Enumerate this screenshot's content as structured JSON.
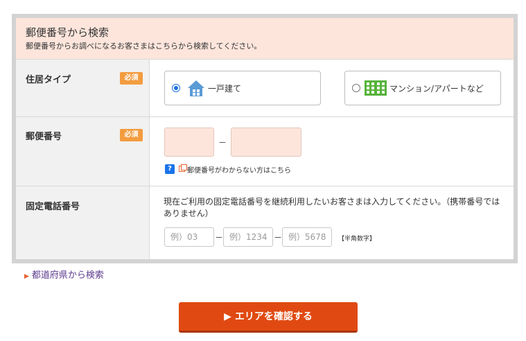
{
  "header": {
    "title": "郵便番号から検索",
    "subtitle": "郵便番号からお調べになるお客さまはこちらから検索してください。"
  },
  "residence": {
    "label": "住居タイプ",
    "required": "必須",
    "options": [
      {
        "label": "一戸建て",
        "icon": "house-icon",
        "selected": true
      },
      {
        "label": "マンション/アパートなど",
        "icon": "apartment-icon",
        "selected": false
      }
    ]
  },
  "zip": {
    "label": "郵便番号",
    "required": "必須",
    "dash": "－",
    "help_link": "郵便番号がわからない方はこちら"
  },
  "phone": {
    "label": "固定電話番号",
    "description": "現在ご利用の固定電話番号を継続利用したいお客さまは入力してください。（携帯番号ではありません）",
    "placeholders": [
      "例）03",
      "例）1234",
      "例）5678"
    ],
    "dash": "－",
    "hankaku": "【半角数字】"
  },
  "prefecture_link": "都道府県から検索",
  "confirm_button": "エリアを確認する",
  "colors": {
    "header_bg": "#fde5dc",
    "required_badge": "#f39c3f",
    "button": "#e04a12",
    "radio_selected": "#1a73e8",
    "house_icon": "#5b9bd5",
    "apartment_icon": "#55b33a"
  }
}
